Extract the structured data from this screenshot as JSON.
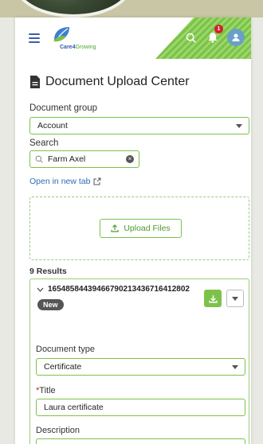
{
  "app": {
    "logo_name": "Care4",
    "logo_suffix": "Growing",
    "notification_count": "1"
  },
  "page": {
    "title": "Document Upload Center"
  },
  "filters": {
    "group_label": "Document group",
    "group_value": "Account",
    "search_label": "Search",
    "search_value": "Farm Axel",
    "open_link": "Open in new tab"
  },
  "upload": {
    "button_label": "Upload Files"
  },
  "results": {
    "count_label": "9 Results",
    "item": {
      "id": "1654858443946679021343671641280​2",
      "badge": "New",
      "doc_type_label": "Document type",
      "doc_type_value": "Certificate",
      "title_required": "*",
      "title_label": "Title",
      "title_value": "Laura certificate",
      "description_label": "Description",
      "description_value": ""
    }
  },
  "colors": {
    "accent": "#7cc24a",
    "link": "#2d6cb8",
    "brand_blue": "#3c5da8"
  },
  "icons": [
    "hamburger-icon",
    "search-icon",
    "bell-icon",
    "user-icon",
    "document-icon",
    "external-link-icon",
    "upload-icon",
    "download-icon",
    "chevron-down-icon",
    "clear-icon"
  ]
}
